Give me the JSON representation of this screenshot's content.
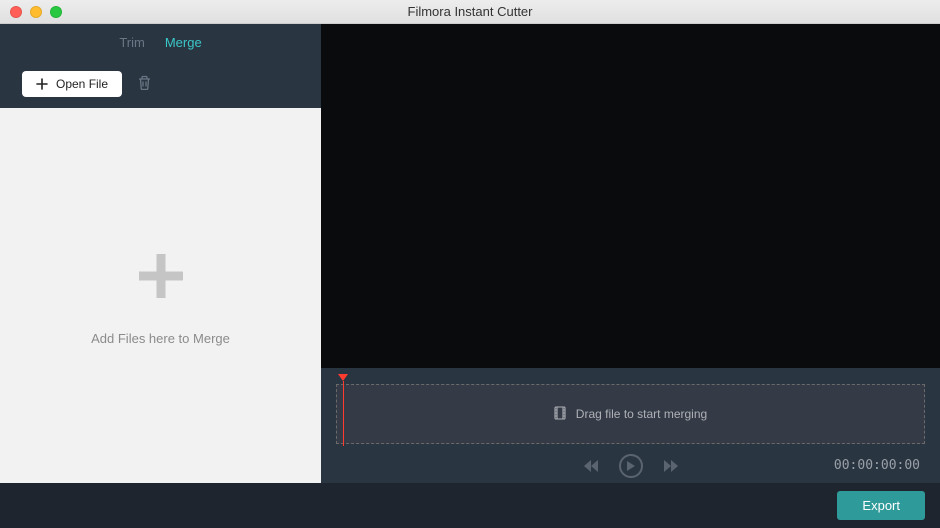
{
  "window": {
    "title": "Filmora Instant Cutter"
  },
  "tabs": {
    "trim": "Trim",
    "merge": "Merge",
    "active": "merge"
  },
  "toolbar": {
    "open_label": "Open File"
  },
  "drop_area": {
    "label": "Add Files here to Merge"
  },
  "timeline": {
    "placeholder": "Drag file to start merging"
  },
  "playback": {
    "timecode": "00:00:00:00"
  },
  "footer": {
    "export_label": "Export"
  },
  "icons": {
    "plus": "plus-icon",
    "trash": "trash-icon",
    "film": "film-icon",
    "prev": "prev-icon",
    "play": "play-icon",
    "next": "next-icon"
  }
}
